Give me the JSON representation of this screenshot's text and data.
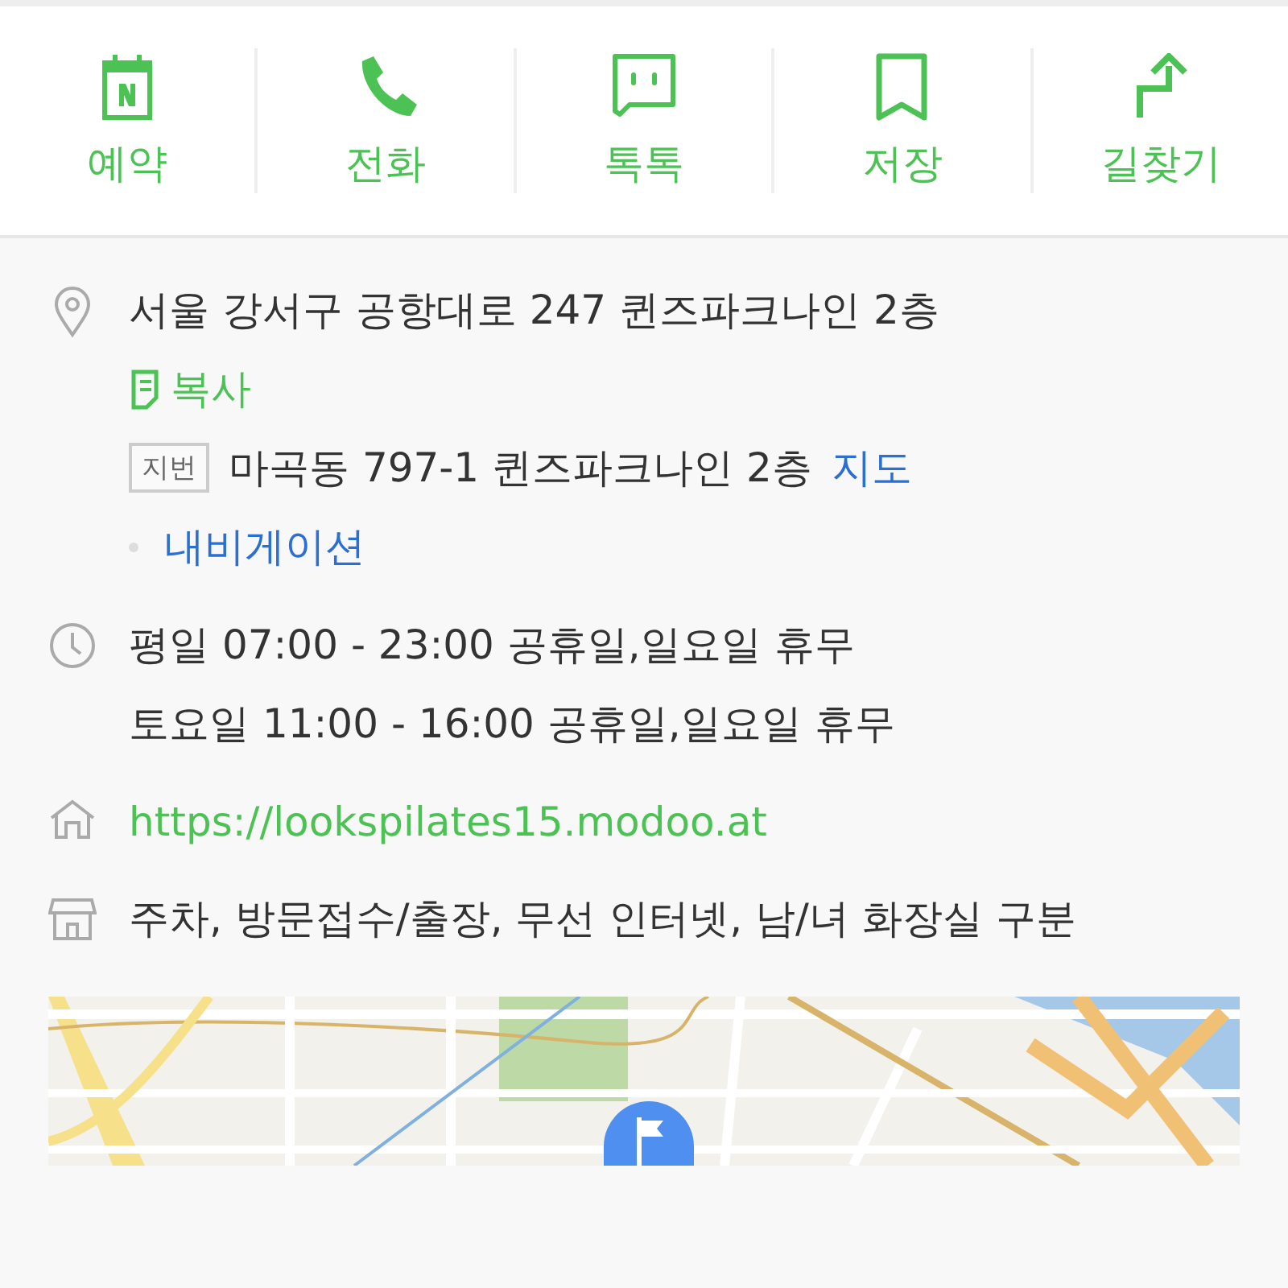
{
  "actions": [
    {
      "kind": "booking",
      "label": "예약"
    },
    {
      "kind": "call",
      "label": "전화"
    },
    {
      "kind": "talk",
      "label": "톡톡"
    },
    {
      "kind": "save",
      "label": "저장"
    },
    {
      "kind": "directions",
      "label": "길찾기"
    }
  ],
  "address": {
    "road": "서울 강서구 공항대로 247 퀸즈파크나인 2층",
    "copy_label": "복사",
    "lot_badge": "지번",
    "lot": "마곡동 797-1 퀸즈파크나인 2층",
    "map_link": "지도",
    "navi_link": "내비게이션"
  },
  "hours": [
    "평일 07:00 - 23:00 공휴일,일요일 휴무",
    "토요일 11:00 - 16:00 공휴일,일요일 휴무"
  ],
  "website": "https://lookspilates15.modoo.at",
  "amenities": "주차, 방문접수/출장, 무선 인터넷, 남/녀 화장실 구분"
}
